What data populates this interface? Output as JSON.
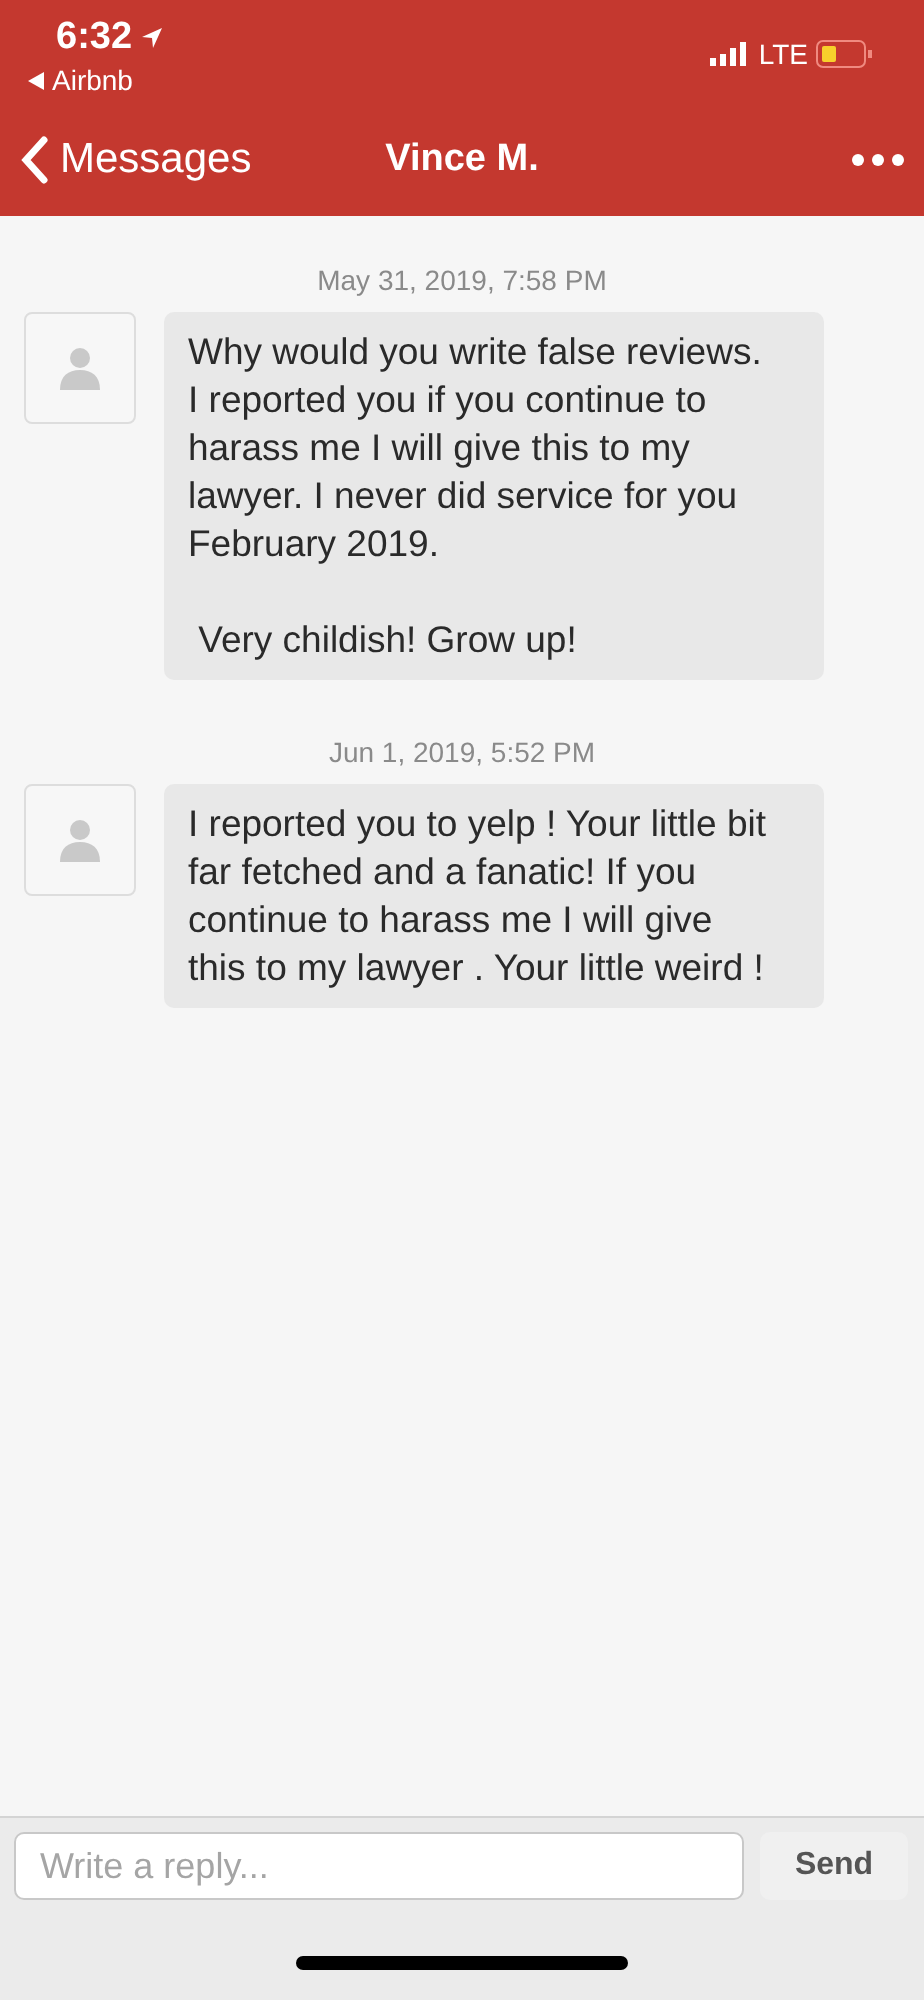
{
  "status_bar": {
    "time": "6:32",
    "back_app": "Airbnb",
    "network": "LTE"
  },
  "nav": {
    "back_label": "Messages",
    "title": "Vince M."
  },
  "messages": [
    {
      "timestamp": "May 31, 2019, 7:58 PM",
      "text": "Why would you write false reviews. I reported you if you continue to harass me I will give this to my lawyer. I never did service for you February 2019.\n\n Very childish! Grow up!"
    },
    {
      "timestamp": "Jun 1, 2019, 5:52 PM",
      "text": "I reported you to yelp ! Your little bit far fetched and a fanatic! If you continue to harass me I will give this to my lawyer . Your little weird !"
    }
  ],
  "composer": {
    "placeholder": "Write a reply...",
    "send_label": "Send"
  }
}
